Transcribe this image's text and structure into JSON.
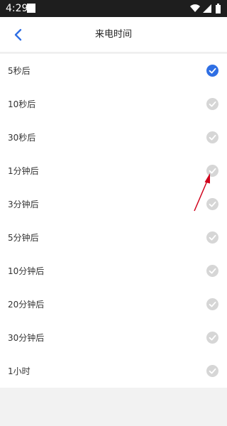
{
  "status_bar": {
    "time": "4:29"
  },
  "header": {
    "title": "来电时间",
    "back_icon": "chevron-left-icon"
  },
  "options": [
    {
      "label": "5秒后",
      "selected": true
    },
    {
      "label": "10秒后",
      "selected": false
    },
    {
      "label": "30秒后",
      "selected": false
    },
    {
      "label": "1分钟后",
      "selected": false
    },
    {
      "label": "3分钟后",
      "selected": false
    },
    {
      "label": "5分钟后",
      "selected": false
    },
    {
      "label": "10分钟后",
      "selected": false
    },
    {
      "label": "20分钟后",
      "selected": false
    },
    {
      "label": "30分钟后",
      "selected": false
    },
    {
      "label": "1小时",
      "selected": false
    }
  ],
  "colors": {
    "accent": "#2f6fe4",
    "unselected_check": "#d6d6d6",
    "status_bar": "#1e1e1e",
    "annotation_arrow": "#d0021b"
  }
}
